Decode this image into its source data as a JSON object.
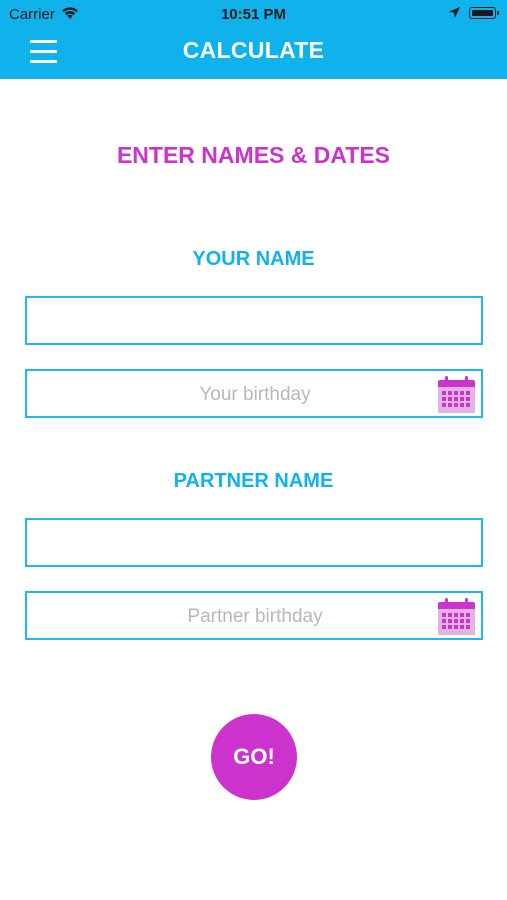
{
  "status_bar": {
    "carrier": "Carrier",
    "time": "10:51 PM"
  },
  "nav": {
    "title": "CALCULATE"
  },
  "form": {
    "heading": "ENTER NAMES & DATES",
    "your_name_label": "YOUR NAME",
    "your_name_value": "",
    "your_birthday_placeholder": "Your birthday",
    "partner_name_label": "PARTNER NAME",
    "partner_name_value": "",
    "partner_birthday_placeholder": "Partner birthday",
    "go_label": "GO!"
  },
  "colors": {
    "header": "#10b2ec",
    "accent": "#cc33cc",
    "border": "#20b8ef",
    "label": "#10b2ec"
  }
}
